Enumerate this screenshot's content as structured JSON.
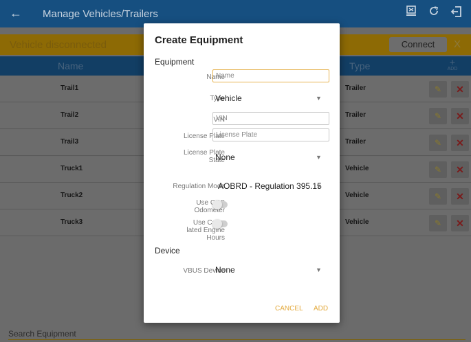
{
  "appbar": {
    "title": "Manage Vehicles/Trailers",
    "back_icon": "←",
    "icons": [
      "eld-icon",
      "refresh-icon",
      "logout-icon"
    ]
  },
  "status": {
    "message": "Vehicle disconnected",
    "connect_label": "Connect",
    "close_label": "X"
  },
  "table": {
    "headers": {
      "name": "Name",
      "type": "Type",
      "add_plus": "+",
      "add": "ADD"
    },
    "rows": [
      {
        "name": "Trail1",
        "type": "Trailer"
      },
      {
        "name": "Trail2",
        "type": "Trailer"
      },
      {
        "name": "Trail3",
        "type": "Trailer"
      },
      {
        "name": "Truck1",
        "type": "Vehicle"
      },
      {
        "name": "Truck2",
        "type": "Vehicle"
      },
      {
        "name": "Truck3",
        "type": "Vehicle"
      }
    ]
  },
  "search": {
    "placeholder": "Search Equipment"
  },
  "dialog": {
    "title": "Create Equipment",
    "section_equipment": "Equipment",
    "name_label": "Name",
    "name_placeholder": "Name",
    "type_label": "Type",
    "type_value": "Vehicle",
    "vin_label": "VIN",
    "vin_placeholder": "VIN",
    "plate_label": "License Plate",
    "plate_placeholder": "License Plate",
    "plate_state_label_1": "License Plate",
    "plate_state_label_2": "State",
    "plate_state_value": "None",
    "regulation_label": "Regulation Mode",
    "regulation_value": "AOBRD - Regulation 395.15",
    "gps_label_1": "Use GPS",
    "gps_label_2": "Odometer",
    "gps_on": false,
    "engine_label_1": "Use Calcu",
    "engine_label_2": "lated Engine",
    "engine_label_3": "Hours",
    "engine_on": false,
    "section_device": "Device",
    "vbus_label": "VBUS Device",
    "vbus_value": "None",
    "cancel_label": "CANCEL",
    "add_label": "ADD"
  }
}
